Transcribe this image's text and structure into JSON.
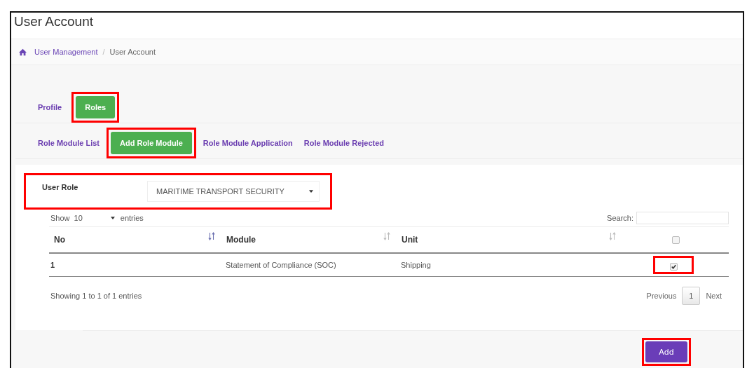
{
  "page": {
    "title": "User Account"
  },
  "breadcrumb_separator": "/",
  "breadcrumb": [
    {
      "label": "User Management",
      "link": true
    },
    {
      "label": "User Account",
      "link": false
    }
  ],
  "tabs": [
    {
      "label": "Profile",
      "selected": false,
      "highlighted": false
    },
    {
      "label": "Roles",
      "selected": true,
      "highlighted": true
    }
  ],
  "subtabs": [
    {
      "label": "Role Module List",
      "selected": false,
      "highlighted": false
    },
    {
      "label": "Add Role Module",
      "selected": true,
      "highlighted": true
    },
    {
      "label": "Role Module Application",
      "selected": false,
      "highlighted": false
    },
    {
      "label": "Role Module Rejected",
      "selected": false,
      "highlighted": false
    }
  ],
  "user_role": {
    "label": "User Role",
    "value": "MARITIME TRANSPORT SECURITY",
    "highlighted": true
  },
  "table": {
    "show_label": "Show",
    "page_size": "10",
    "entries_label": "entries",
    "search_label": "Search:",
    "columns": [
      "No",
      "Module",
      "Unit"
    ],
    "select_all": {
      "checked": false,
      "highlighted": false
    },
    "rows": [
      {
        "cells": [
          "1",
          "Statement of Compliance (SOC)",
          "Shipping"
        ],
        "checked": true,
        "highlighted": true
      }
    ],
    "info": "Showing 1 to 1 of 1 entries",
    "pagination": {
      "previous": "Previous",
      "pages": [
        {
          "label": "1",
          "selected": true
        }
      ],
      "next": "Next"
    }
  },
  "footer": {
    "button": "Add",
    "highlighted": true
  }
}
